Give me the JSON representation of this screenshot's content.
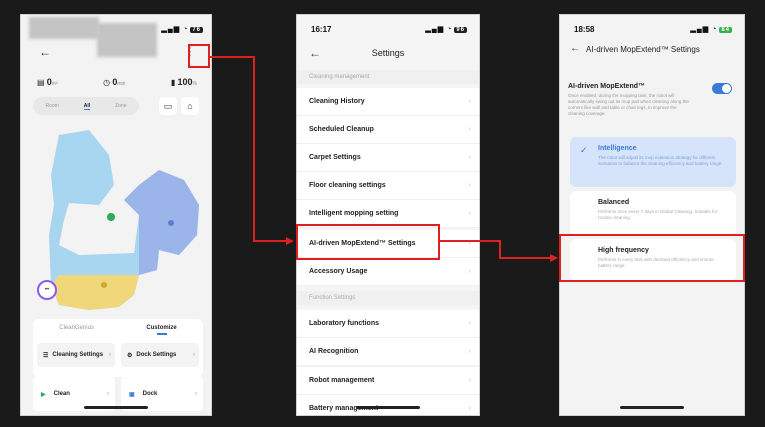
{
  "phone1": {
    "stats": [
      {
        "value": "0",
        "unit": "m²"
      },
      {
        "value": "0",
        "unit": "min"
      },
      {
        "value": "100",
        "unit": "%"
      }
    ],
    "modes": [
      "Room",
      "All",
      "Zone"
    ],
    "tabs": [
      "CleanGenius",
      "Customize"
    ],
    "buttons": {
      "cleaning_settings": "Cleaning Settings",
      "dock_settings": "Dock Settings",
      "clean": "Clean",
      "dock": "Dock"
    }
  },
  "phone2": {
    "time": "16:17",
    "battery": "96",
    "title": "Settings",
    "section1": "Cleaning management",
    "section2": "Function Settings",
    "items1": [
      "Cleaning History",
      "Scheduled Cleanup",
      "Carpet Settings",
      "Floor cleaning settings",
      "Intelligent mopping setting",
      "AI-driven MopExtend™ Settings",
      "Accessory Usage"
    ],
    "items2": [
      "Laboratory functions",
      "AI Recognition",
      "Robot management",
      "Battery management"
    ]
  },
  "phone3": {
    "time": "18:58",
    "battery": "84",
    "title": "AI-driven MopExtend™ Settings",
    "mop_title": "AI-driven MopExtend™",
    "mop_desc": "Once enabled, during the mopping task, the robot will automatically swing out its mop pad when cleaning along the corners like wall and table or chair legs, to improve the cleaning coverage.",
    "options": [
      {
        "title": "Intelligence",
        "desc": "The robot will adjust its mop extension strategy for different scenarios to balance the cleaning efficiency and battery range."
      },
      {
        "title": "Balanced",
        "desc": "Performs once every 7 days in Global Cleaning. Suitable for routine cleaning."
      },
      {
        "title": "High frequency",
        "desc": "Performs in every task with declined efficiency and shorter battery range."
      }
    ]
  },
  "colors": {
    "annotation": "#e02020",
    "accent": "#3a7bd5"
  }
}
